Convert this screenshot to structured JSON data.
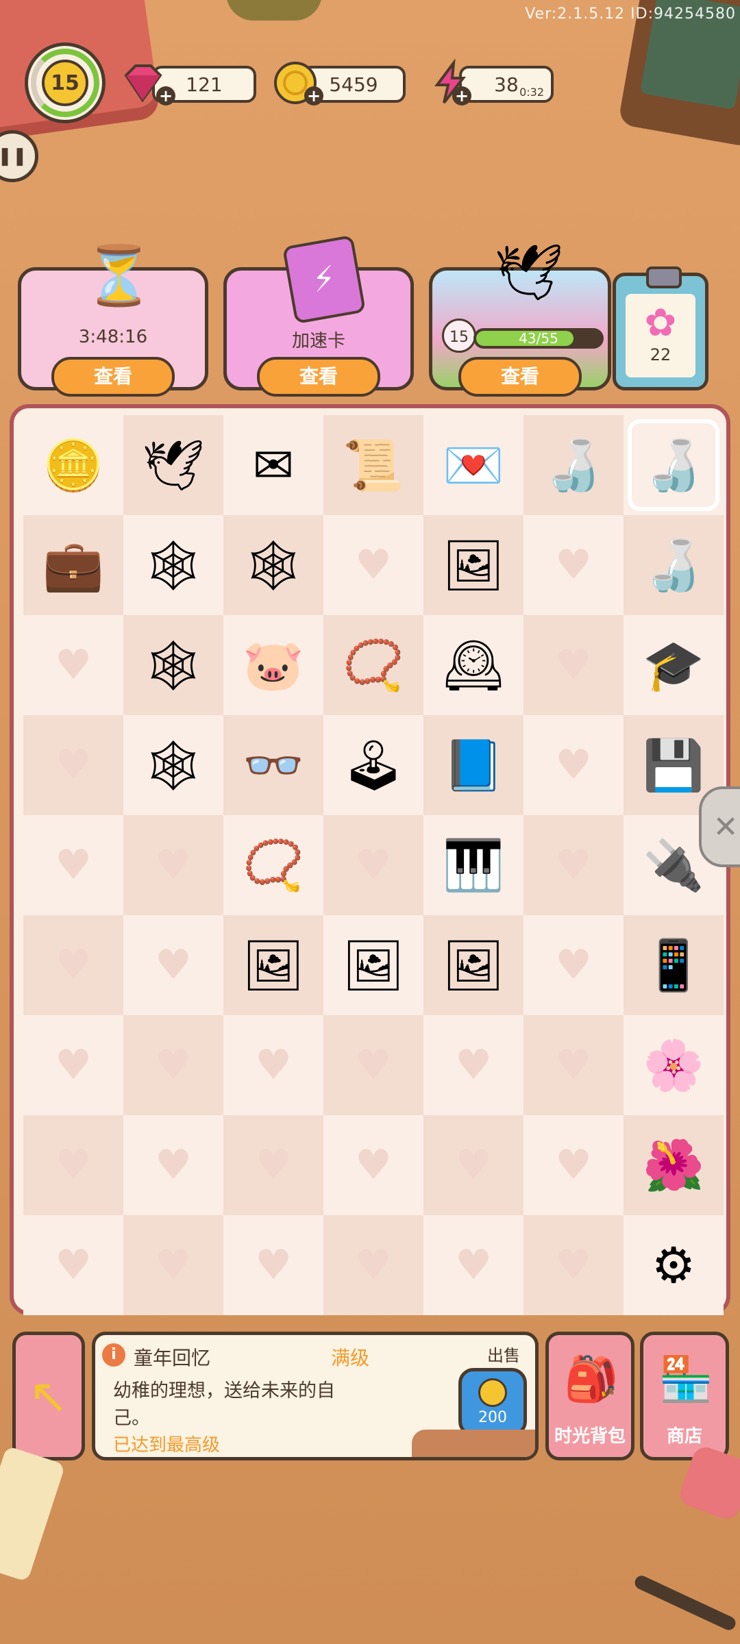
{
  "version": "Ver:2.1.5.12 ID:94254580",
  "level": "15",
  "resources": {
    "gems": "121",
    "coins": "5459",
    "energy": "38",
    "energy_timer": "0:32"
  },
  "cards": [
    {
      "label": "3:48:16",
      "button": "查看"
    },
    {
      "label": "加速卡",
      "button": "查看"
    },
    {
      "progress_text": "43/55",
      "progress": 0.78,
      "level": "15",
      "button": "查看"
    }
  ],
  "clipboard_count": "22",
  "board": {
    "columns": 7,
    "rows": 9,
    "cells": [
      [
        "coins-icon",
        "paper-crane-icon",
        "letter-icon",
        "letters-quill-icon",
        "love-letter-icon",
        "crane-bottle-icon",
        "crane-bottle-icon"
      ],
      [
        "briefcase-icon",
        "webbed-crane-icon",
        "webbed-letters-icon",
        "",
        "photo-icon",
        "",
        "crane-bottle-icon"
      ],
      [
        "",
        "webbed-letter-icon",
        "piggy-bank-icon",
        "locket-icon",
        "grandfather-clock-icon",
        "",
        "graduation-cap-icon"
      ],
      [
        "",
        "webbed-crane-icon",
        "glasses-icon",
        "arcade-machine-icon",
        "energy-book-icon",
        "",
        "circuit-board-icon"
      ],
      [
        "",
        "",
        "locket-icon",
        "",
        "piano-icon",
        "",
        "cable-icon"
      ],
      [
        "",
        "",
        "photo-icon",
        "photo-icon",
        "photo-icon",
        "",
        "tablet-icon"
      ],
      [
        "",
        "",
        "",
        "",
        "",
        "",
        "flower-icon"
      ],
      [
        "",
        "",
        "",
        "",
        "",
        "",
        "double-flower-icon"
      ],
      [
        "",
        "",
        "",
        "",
        "",
        "",
        "gear-icon"
      ]
    ]
  },
  "info": {
    "title": "童年回忆",
    "level": "满级",
    "description": "幼稚的理想，送给未来的自己。",
    "status": "已达到最高级",
    "sell_label": "出售",
    "sell_price": "200"
  },
  "buttons": {
    "backpack": "时光背包",
    "shop": "商店"
  }
}
